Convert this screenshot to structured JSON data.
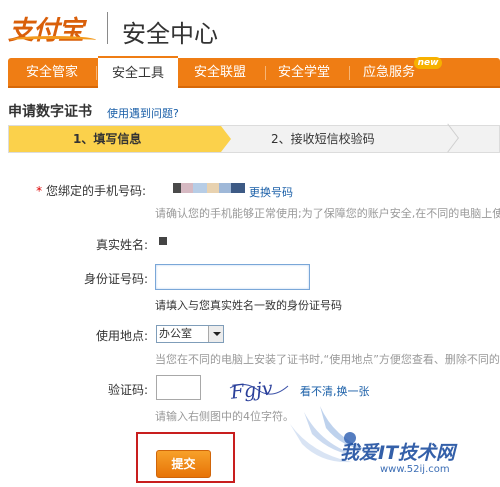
{
  "header": {
    "logo_text": "支付宝",
    "title": "安全中心"
  },
  "nav": {
    "items": [
      {
        "label": "安全管家",
        "active": false
      },
      {
        "label": "安全工具",
        "active": true
      },
      {
        "label": "安全联盟",
        "active": false
      },
      {
        "label": "安全学堂",
        "active": false
      },
      {
        "label": "应急服务",
        "active": false
      }
    ],
    "new_badge": "new"
  },
  "page": {
    "heading": "申请数字证书",
    "help_link": "使用遇到问题?"
  },
  "steps": {
    "step1": "1、填写信息",
    "step2": "2、接收短信校验码"
  },
  "form": {
    "phone_label": "您绑定的手机号码:",
    "phone_change_link": "更换号码",
    "phone_hint": "请确认您的手机能够正常使用;为了保障您的账户安全,在不同的电脑上使",
    "name_label": "真实姓名:",
    "id_label": "身份证号码:",
    "id_value": "",
    "id_note": "请填入与您真实姓名一致的身份证号码",
    "location_label": "使用地点:",
    "location_selected": "办公室",
    "location_hint": "当您在不同的电脑上安装了证书时,“使用地点”方便您查看、删除不同的证",
    "code_label": "验证码:",
    "code_value": "",
    "captcha_text": "Fgjv",
    "captcha_refresh": "看不清,换一张",
    "code_hint": "请输入右侧图中的4位字符。",
    "submit_label": "提交"
  },
  "watermark": {
    "text": "我爱IT技术网",
    "url": "www.52ij.com"
  },
  "colors": {
    "nav_orange": "#ef7d14",
    "step_yellow": "#fbd14b",
    "link_blue": "#1a5fa8",
    "submit_frame_red": "#c81e1e"
  }
}
